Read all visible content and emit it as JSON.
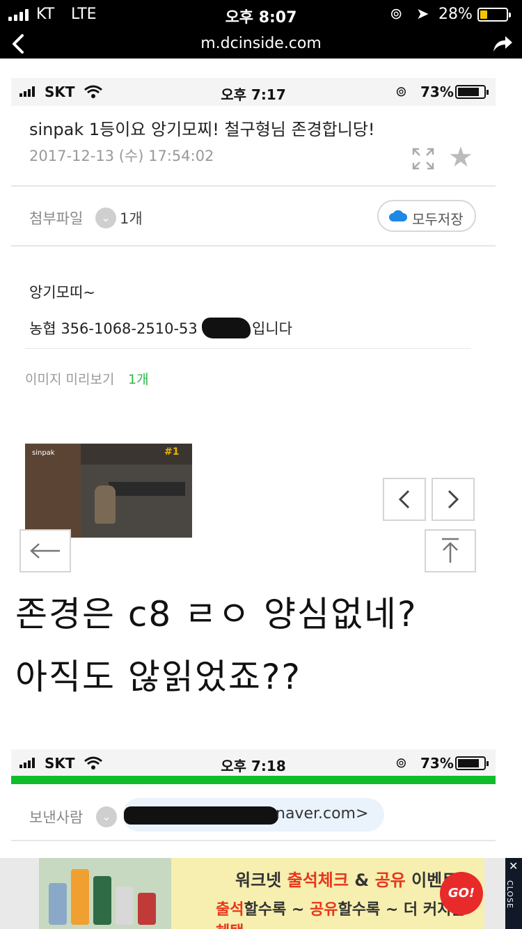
{
  "os_status": {
    "carrier": "KT",
    "network": "LTE",
    "time": "오후 8:07",
    "battery": "28%"
  },
  "browser": {
    "url": "m.dcinside.com"
  },
  "screenshot_status_1": {
    "carrier": "SKT",
    "time": "오후 7:17",
    "battery": "73%"
  },
  "mail": {
    "subject": "sinpak 1등이요 앙기모찌! 철구형님 존경합니당!",
    "date": "2017-12-13 (수) 17:54:02",
    "attachment_label": "첨부파일",
    "attachment_count": "1개",
    "save_all": "모두저장",
    "body_line1": "앙기모띠~",
    "body_line2": "농협 356-1068-2510-53",
    "body_line2_suffix": "입니다",
    "preview_label": "이미지 미리보기",
    "preview_count": "1개"
  },
  "thumbnail": {
    "name": "sinpak",
    "rank": "#1"
  },
  "caption": {
    "line1": "존경은 c8 ㄹㅇ 양심없네?",
    "line2": "아직도 않읽었죠??"
  },
  "screenshot_status_2": {
    "carrier": "SKT",
    "time": "오후 7:18",
    "battery": "73%"
  },
  "sender": {
    "label": "보낸사람",
    "domain": "naver.com>"
  },
  "ad": {
    "line1_a": "워크넷 ",
    "line1_b": "출석체크",
    "line1_c": " & ",
    "line1_d": "공유",
    "line1_e": " 이벤트",
    "line2_a": "출석",
    "line2_b": "할수록 ~ ",
    "line2_c": "공유",
    "line2_d": "할수록 ~ 더 커지는 ",
    "line2_e": "혜택",
    "go": "GO!",
    "close": "CLOSE"
  },
  "colors": {
    "green_bar": "#0fbd2c",
    "preview_count": "#2db84a",
    "ad_highlight": "#e8361b"
  }
}
